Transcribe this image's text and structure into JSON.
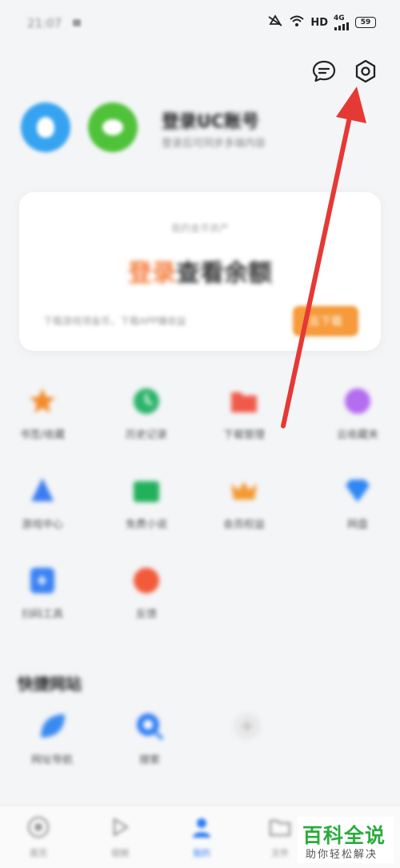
{
  "status_bar": {
    "time": "21:07",
    "network_label": "HD",
    "signal_label": "4G",
    "battery": "59"
  },
  "header": {
    "messages_icon": "chat-bubble-icon",
    "settings_icon": "hexagon-gear-icon"
  },
  "profile": {
    "title": "登录UC账号",
    "subtitle": "登录后可同步多端内容"
  },
  "balance_card": {
    "caption": "我的金币资产",
    "main_accent": "登录",
    "main_rest": "查看余额",
    "footer": "下载游戏领金币，下载APP赚收益",
    "button_label": "去下载"
  },
  "grid": [
    {
      "label": "书签/收藏",
      "icon": "star-icon",
      "color": "#f48a2a"
    },
    {
      "label": "历史记录",
      "icon": "clock-icon",
      "color": "#2bb36a"
    },
    {
      "label": "下载管理",
      "icon": "download-folder-icon",
      "color": "#f05a4a"
    },
    {
      "label": "云收藏夹",
      "icon": "cloud-icon",
      "color": "#b46cf0"
    },
    {
      "label": "游戏中心",
      "icon": "game-icon",
      "color": "#3a7cf0"
    },
    {
      "label": "免费小说",
      "icon": "book-icon",
      "color": "#22b05a"
    },
    {
      "label": "会员权益",
      "icon": "crown-icon",
      "color": "#f49a32"
    },
    {
      "label": "网盘",
      "icon": "diamond-icon",
      "color": "#2e86f2"
    },
    {
      "label": "扫码工具",
      "icon": "scan-icon",
      "color": "#3a82f2"
    },
    {
      "label": "反馈",
      "icon": "circle-icon",
      "color": "#f25a3a"
    }
  ],
  "quick_section": {
    "title": "快捷网站",
    "items": [
      {
        "label": "网址导航",
        "icon": "leaf-icon",
        "color": "#3a8af2"
      },
      {
        "label": "搜索",
        "icon": "search-icon",
        "color": "#2e7cf6"
      },
      {
        "label": "",
        "icon": "add-icon",
        "color": "#dddddd"
      }
    ]
  },
  "bottom_nav": [
    {
      "label": "首页",
      "icon": "home-icon"
    },
    {
      "label": "视频",
      "icon": "play-icon"
    },
    {
      "label": "我的",
      "icon": "person-icon"
    },
    {
      "label": "文件",
      "icon": "folder-icon"
    }
  ],
  "watermark": {
    "title": "百科全说",
    "subtitle": "助你轻松解决"
  },
  "colors": {
    "annotation_arrow": "#e53935",
    "accent_orange": "#f47b3a",
    "brand_green": "#2aab3c"
  }
}
